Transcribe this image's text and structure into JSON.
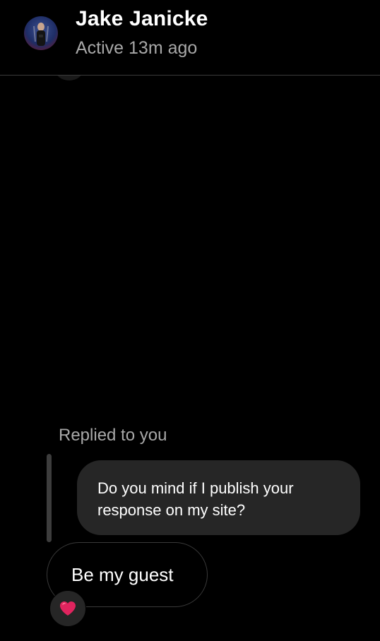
{
  "header": {
    "contact_name": "Jake Janicke",
    "status": "Active 13m ago",
    "avatar_icon": "profile-photo"
  },
  "conversation": {
    "replied_label": "Replied to you",
    "quoted_message": "Do you mind if I publish your response on my site?",
    "reply_message": "Be my guest",
    "reaction": {
      "icon": "red-heart-icon",
      "color": "#e0245e"
    }
  },
  "colors": {
    "background": "#000000",
    "bubble": "#262626",
    "secondary_text": "#a8a8a8",
    "divider": "#3a3a3a"
  }
}
